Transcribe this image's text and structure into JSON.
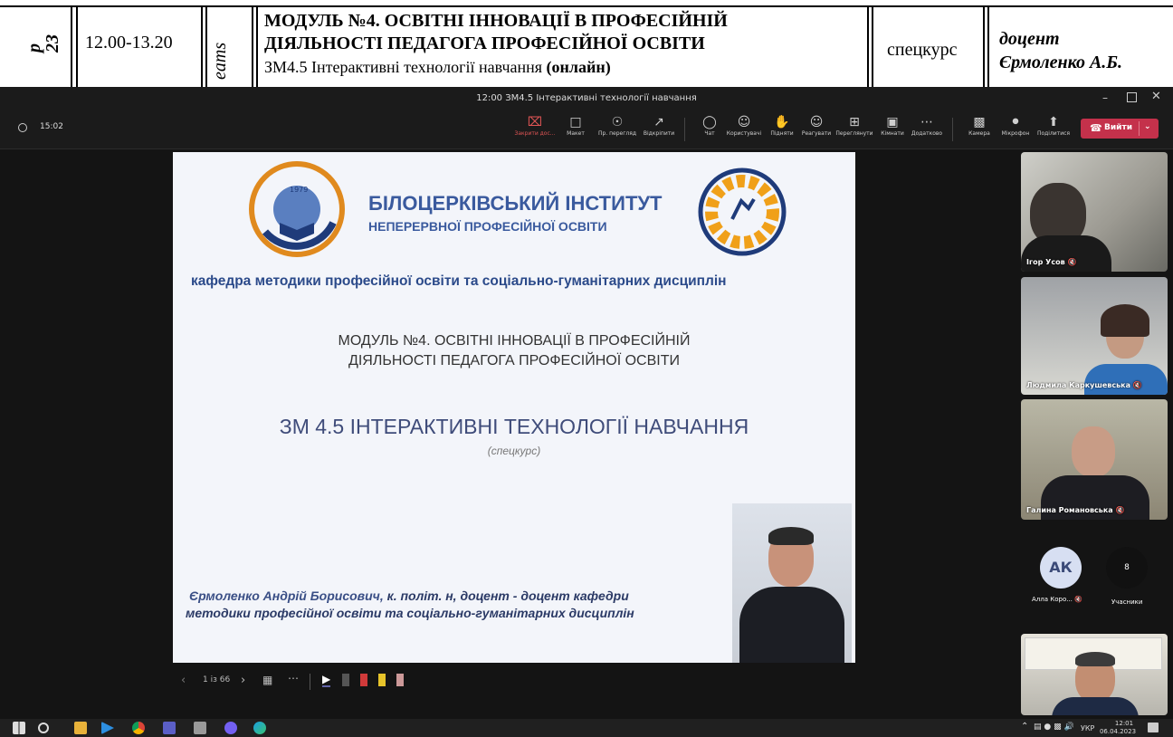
{
  "document_strip": {
    "side_letters": "р\n23",
    "time": "12.00-13.20",
    "vertical_word": "eams",
    "course_line1": "МОДУЛЬ №4. ОСВІТНІ ІННОВАЦІЇ В ПРОФЕСІЙНІЙ",
    "course_line2": "ДІЯЛЬНОСТІ ПЕДАГОГА ПРОФЕСІЙНОЇ ОСВІТИ",
    "course_line3_prefix": "ЗМ4.5 Інтерактивні технології навчання ",
    "course_line3_bold": "(онлайн)",
    "type": "спецкурс",
    "lecturer_title": "доцент",
    "lecturer_name": "Єрмоленко А.Б."
  },
  "window": {
    "title": "12:00 ЗМ4.5 Інтерактивні технології навчання",
    "timer": "15:02"
  },
  "toolbar": {
    "stop_sharing": "Закрити дос...",
    "layout": "Макет",
    "presenter_view": "Пр. перегляд",
    "pop_out": "Відкріпити",
    "chat": "Чат",
    "people": "Користувачі",
    "raise": "Підняти",
    "react": "Реагувати",
    "view": "Переглянути",
    "rooms": "Кімнати",
    "more": "Додатково",
    "camera": "Камера",
    "mic": "Мікрофон",
    "share": "Поділитися",
    "leave": "Вийти"
  },
  "slide": {
    "institute_line1": "БІЛОЦЕРКІВСЬКИЙ  ІНСТИТУТ",
    "institute_line2": "НЕПЕРЕРВНОЇ ПРОФЕСІЙНОЇ ОСВІТИ",
    "department": "кафедра методики професійної освіти та соціально-гуманітарних дисциплін",
    "module_line1": "МОДУЛЬ №4. ОСВІТНІ ІННОВАЦІЇ В ПРОФЕСІЙНІЙ",
    "module_line2": "ДІЯЛЬНОСТІ ПЕДАГОГА ПРОФЕСІЙНОЇ ОСВІТИ",
    "topic": "ЗМ 4.5 ІНТЕРАКТИВНІ ТЕХНОЛОГІЇ НАВЧАННЯ",
    "subtitle": "(спецкурс)",
    "author_name": "Єрмоленко Андрій Борисович,",
    "author_rest": " к. політ. н, доцент - доцент кафедри",
    "author_line2": "методики професійної освіти та соціально-гуманітарних дисциплін",
    "logo_year": "1979"
  },
  "slide_controls": {
    "page": "1 із 66"
  },
  "participants": {
    "p1": "Ігор Усов",
    "p2": "Людмила Каркушевська",
    "p3": "Галина Романовська",
    "p4_initials": "АК",
    "p4_name": "Алла Коро...",
    "others_count": "8",
    "others_label": "Учасники"
  },
  "taskbar": {
    "lang": "УКР",
    "time": "12:01",
    "date": "06.04.2023"
  }
}
